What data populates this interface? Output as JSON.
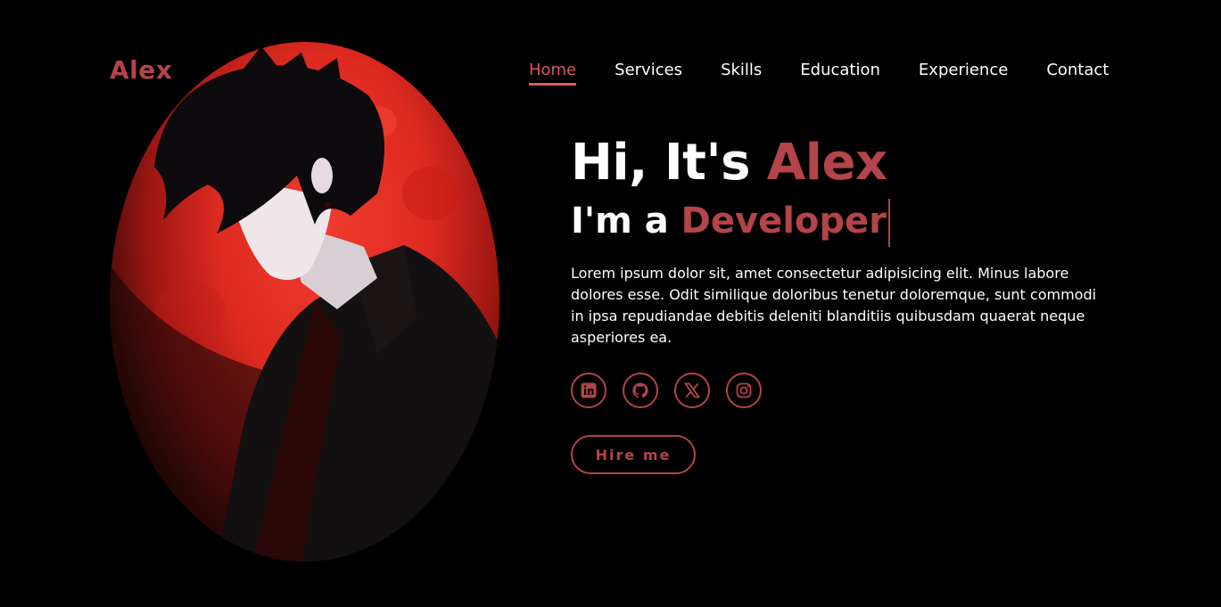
{
  "header": {
    "logo": "Alex"
  },
  "nav": {
    "items": [
      {
        "label": "Home",
        "active": true
      },
      {
        "label": "Services"
      },
      {
        "label": "Skills"
      },
      {
        "label": "Education"
      },
      {
        "label": "Experience"
      },
      {
        "label": "Contact"
      }
    ]
  },
  "hero": {
    "greeting_prefix": "Hi, It's ",
    "name": "Alex",
    "role_prefix": "I'm a ",
    "role": "Developer",
    "description": "Lorem ipsum dolor sit, amet consectetur adipisicing elit. Minus labore dolores esse. Odit similique doloribus tenetur doloremque, sunt commodi in ipsa repudiandae debitis deleniti blanditiis quibusdam quaerat neque asperiores ea.",
    "hire_label": "Hire me"
  },
  "socials": [
    {
      "icon": "linkedin-icon"
    },
    {
      "icon": "github-icon"
    },
    {
      "icon": "x-icon"
    },
    {
      "icon": "instagram-icon"
    }
  ],
  "colors": {
    "accent": "#b3444a",
    "background": "#000000",
    "moon": "#e0241a"
  }
}
